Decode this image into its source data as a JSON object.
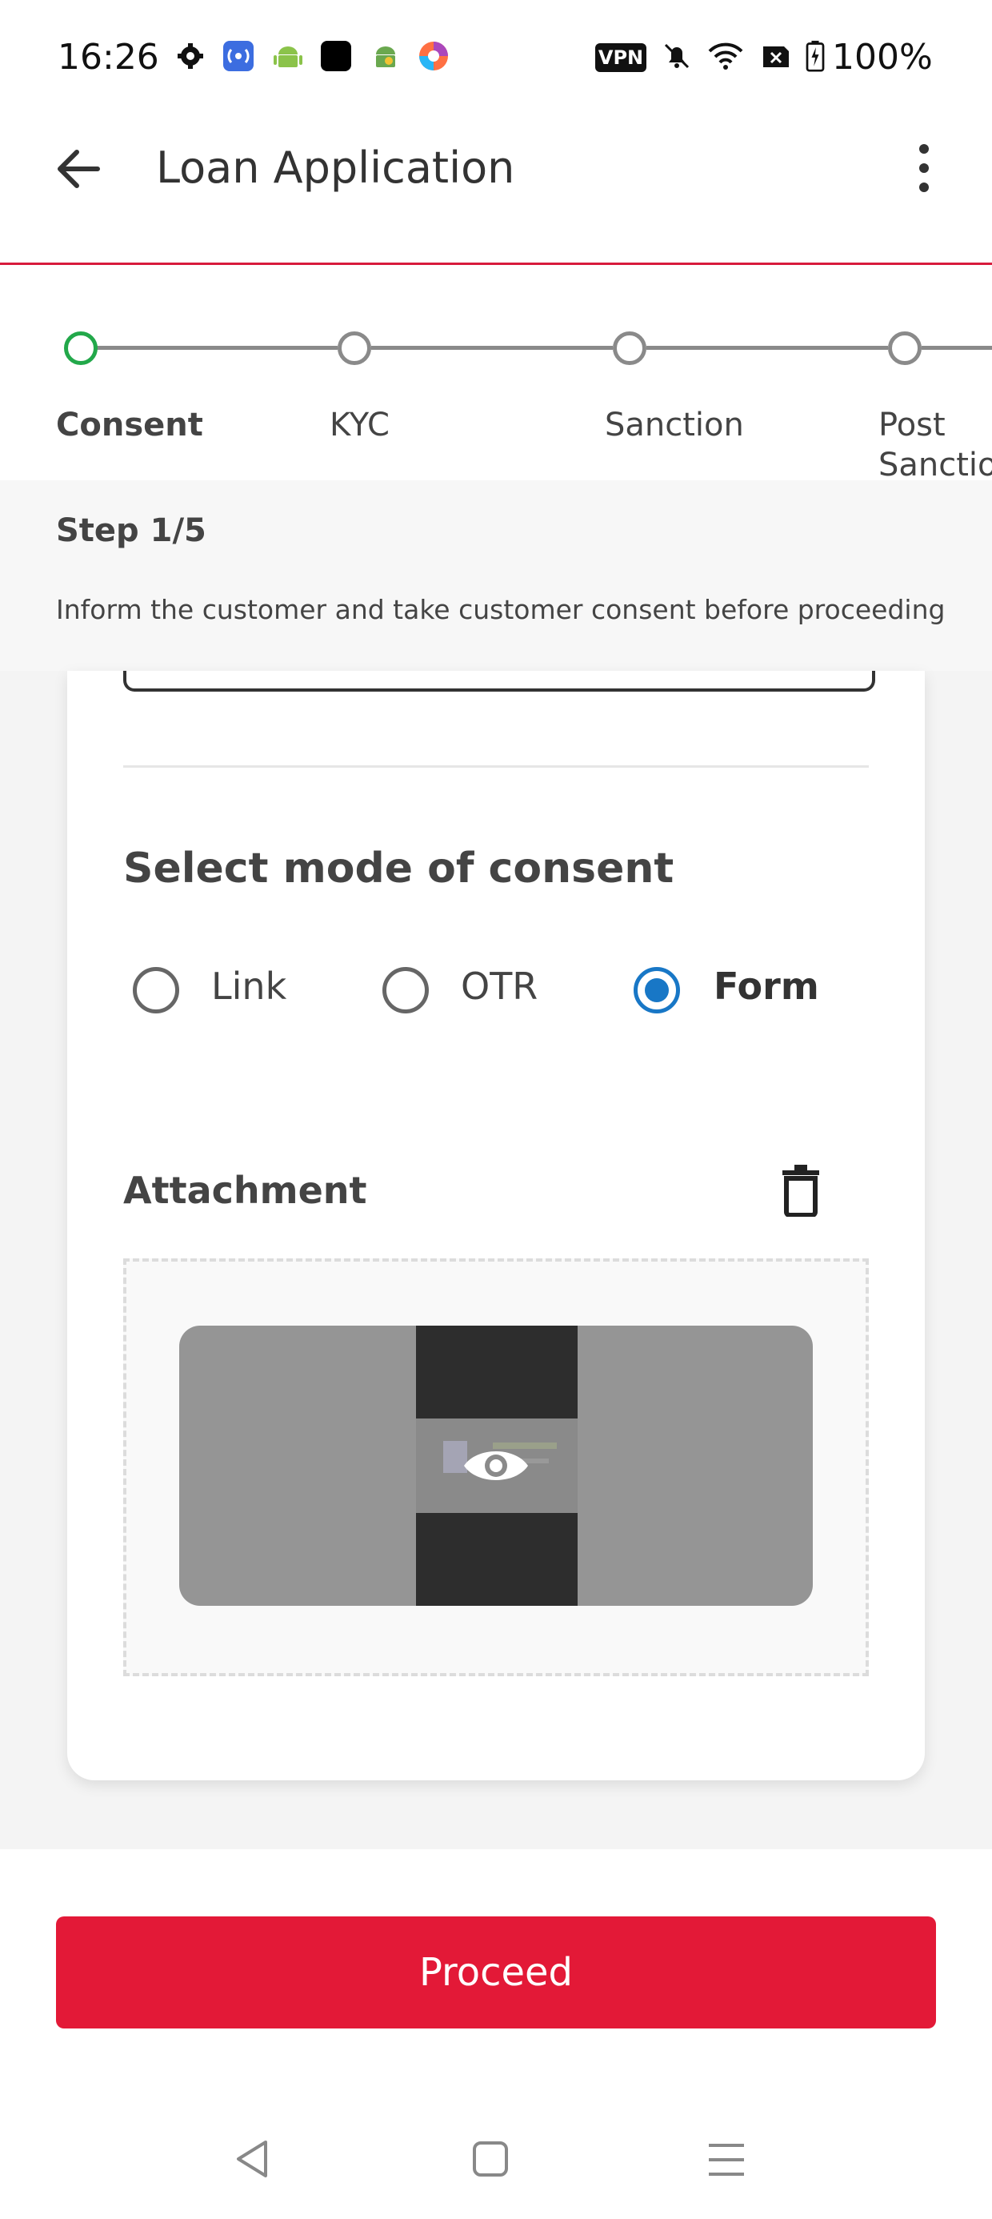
{
  "status_bar": {
    "time": "16:26",
    "battery": "100%",
    "vpn_label": "VPN",
    "icons": [
      "settings-icon",
      "broadcast-app-icon",
      "android-icon",
      "black-square-app-icon",
      "android-app-icon",
      "browser-app-icon",
      "vpn-icon",
      "mute-bell-icon",
      "wifi-icon",
      "sim-off-icon",
      "battery-icon"
    ]
  },
  "app_bar": {
    "title": "Loan Application",
    "accent": "#d81b3c"
  },
  "stepper": {
    "steps": [
      {
        "label": "Consent",
        "active": true
      },
      {
        "label": "KYC",
        "active": false
      },
      {
        "label": "Sanction",
        "active": false
      },
      {
        "label": "Post Sanction",
        "active": false
      }
    ],
    "active_color": "#22a84a"
  },
  "info": {
    "step_count": "Step 1/5",
    "description": "Inform the customer and take customer consent before proceeding"
  },
  "consent": {
    "title": "Select mode of consent",
    "options": [
      {
        "label": "Link",
        "selected": false
      },
      {
        "label": "OTR",
        "selected": false
      },
      {
        "label": "Form",
        "selected": true
      }
    ],
    "selected_color": "#1877c6"
  },
  "attachment": {
    "title": "Attachment"
  },
  "footer": {
    "proceed_label": "Proceed",
    "button_color": "#e31937"
  }
}
